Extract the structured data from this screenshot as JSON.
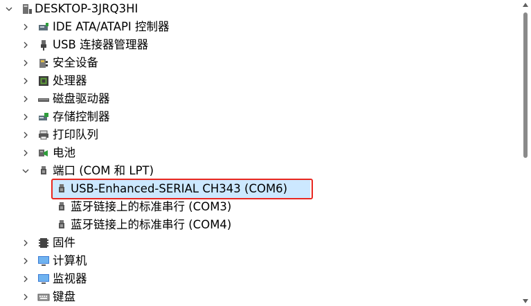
{
  "root": {
    "label": "DESKTOP-3JRQ3HI",
    "icon": "computer-icon"
  },
  "categories": [
    {
      "label": "IDE ATA/ATAPI 控制器",
      "icon": "ide-controller-icon",
      "expanded": false
    },
    {
      "label": "USB 连接器管理器",
      "icon": "usb-icon",
      "expanded": false
    },
    {
      "label": "安全设备",
      "icon": "security-device-icon",
      "expanded": false
    },
    {
      "label": "处理器",
      "icon": "processor-icon",
      "expanded": false
    },
    {
      "label": "磁盘驱动器",
      "icon": "disk-drive-icon",
      "expanded": false
    },
    {
      "label": "存储控制器",
      "icon": "storage-controller-icon",
      "expanded": false
    },
    {
      "label": "打印队列",
      "icon": "printer-icon",
      "expanded": false
    },
    {
      "label": "电池",
      "icon": "battery-icon",
      "expanded": false
    },
    {
      "label": "端口 (COM 和 LPT)",
      "icon": "port-icon",
      "expanded": true,
      "children": [
        {
          "label": "USB-Enhanced-SERIAL CH343 (COM6)",
          "icon": "port-icon",
          "selected": true
        },
        {
          "label": "蓝牙链接上的标准串行 (COM3)",
          "icon": "port-icon"
        },
        {
          "label": "蓝牙链接上的标准串行 (COM4)",
          "icon": "port-icon"
        }
      ]
    },
    {
      "label": "固件",
      "icon": "firmware-icon",
      "expanded": false
    },
    {
      "label": "计算机",
      "icon": "monitor-icon",
      "expanded": false
    },
    {
      "label": "监视器",
      "icon": "monitor-icon",
      "expanded": false
    },
    {
      "label": "键盘",
      "icon": "keyboard-icon",
      "expanded": false
    }
  ],
  "colors": {
    "selection": "#cce8ff",
    "highlight_border": "#e8261f"
  }
}
